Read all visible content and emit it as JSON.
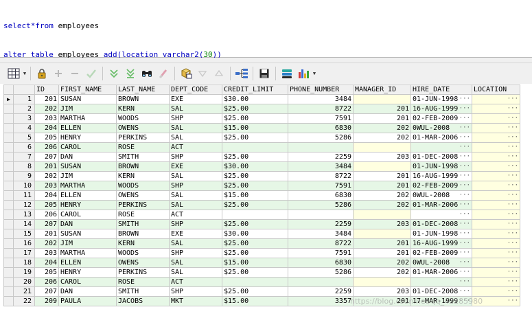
{
  "editor": {
    "line1": [
      {
        "text": "select*from",
        "cls": "kw"
      },
      {
        "text": " employees",
        "cls": "plain"
      }
    ],
    "line2": [
      {
        "text": "alter table",
        "cls": "kw"
      },
      {
        "text": " employees ",
        "cls": "plain"
      },
      {
        "text": "add(location varchar2(",
        "cls": "kw"
      },
      {
        "text": "30",
        "cls": "num"
      },
      {
        "text": "))",
        "cls": "kw"
      }
    ]
  },
  "toolbar": {
    "icons": [
      "grid-options-icon",
      "lock-icon",
      "add-record-icon",
      "delete-record-icon",
      "post-changes-icon",
      "fetch-next-icon",
      "fetch-last-icon",
      "find-icon",
      "clear-icon",
      "query-by-example-icon",
      "filter-down-icon",
      "filter-up-icon",
      "tree-view-icon",
      "save-icon",
      "export-icon",
      "chart-icon"
    ]
  },
  "grid": {
    "columns": [
      "ID",
      "FIRST_NAME",
      "LAST_NAME",
      "DEPT_CODE",
      "CREDIT_LIMIT",
      "PHONE_NUMBER",
      "MANAGER_ID",
      "HIRE_DATE",
      "LOCATION"
    ],
    "rows": [
      {
        "n": "1",
        "id": "201",
        "first": "SUSAN",
        "last": "BROWN",
        "dept": "EXE",
        "credit": "$30.00",
        "phone": "3484",
        "mgr": "",
        "hire": "01-JUN-1998"
      },
      {
        "n": "2",
        "id": "202",
        "first": "JIM",
        "last": "KERN",
        "dept": "SAL",
        "credit": "$25.00",
        "phone": "8722",
        "mgr": "201",
        "hire": "16-AUG-1999"
      },
      {
        "n": "3",
        "id": "203",
        "first": "MARTHA",
        "last": "WOODS",
        "dept": "SHP",
        "credit": "$25.00",
        "phone": "7591",
        "mgr": "201",
        "hire": "02-FEB-2009"
      },
      {
        "n": "4",
        "id": "204",
        "first": "ELLEN",
        "last": "OWENS",
        "dept": "SAL",
        "credit": "$15.00",
        "phone": "6830",
        "mgr": "202",
        "hire": "0WUL-2008"
      },
      {
        "n": "5",
        "id": "205",
        "first": "HENRY",
        "last": "PERKINS",
        "dept": "SAL",
        "credit": "$25.00",
        "phone": "5286",
        "mgr": "202",
        "hire": "01-MAR-2006"
      },
      {
        "n": "6",
        "id": "206",
        "first": "CAROL",
        "last": "ROSE",
        "dept": "ACT",
        "credit": "",
        "phone": "",
        "mgr": "",
        "hire": ""
      },
      {
        "n": "7",
        "id": "207",
        "first": "DAN",
        "last": "SMITH",
        "dept": "SHP",
        "credit": "$25.00",
        "phone": "2259",
        "mgr": "203",
        "hire": "01-DEC-2008"
      },
      {
        "n": "8",
        "id": "201",
        "first": "SUSAN",
        "last": "BROWN",
        "dept": "EXE",
        "credit": "$30.00",
        "phone": "3484",
        "mgr": "",
        "hire": "01-JUN-1998"
      },
      {
        "n": "9",
        "id": "202",
        "first": "JIM",
        "last": "KERN",
        "dept": "SAL",
        "credit": "$25.00",
        "phone": "8722",
        "mgr": "201",
        "hire": "16-AUG-1999"
      },
      {
        "n": "10",
        "id": "203",
        "first": "MARTHA",
        "last": "WOODS",
        "dept": "SHP",
        "credit": "$25.00",
        "phone": "7591",
        "mgr": "201",
        "hire": "02-FEB-2009"
      },
      {
        "n": "11",
        "id": "204",
        "first": "ELLEN",
        "last": "OWENS",
        "dept": "SAL",
        "credit": "$15.00",
        "phone": "6830",
        "mgr": "202",
        "hire": "0WUL-2008"
      },
      {
        "n": "12",
        "id": "205",
        "first": "HENRY",
        "last": "PERKINS",
        "dept": "SAL",
        "credit": "$25.00",
        "phone": "5286",
        "mgr": "202",
        "hire": "01-MAR-2006"
      },
      {
        "n": "13",
        "id": "206",
        "first": "CAROL",
        "last": "ROSE",
        "dept": "ACT",
        "credit": "",
        "phone": "",
        "mgr": "",
        "hire": ""
      },
      {
        "n": "14",
        "id": "207",
        "first": "DAN",
        "last": "SMITH",
        "dept": "SHP",
        "credit": "$25.00",
        "phone": "2259",
        "mgr": "203",
        "hire": "01-DEC-2008"
      },
      {
        "n": "15",
        "id": "201",
        "first": "SUSAN",
        "last": "BROWN",
        "dept": "EXE",
        "credit": "$30.00",
        "phone": "3484",
        "mgr": "",
        "hire": "01-JUN-1998"
      },
      {
        "n": "16",
        "id": "202",
        "first": "JIM",
        "last": "KERN",
        "dept": "SAL",
        "credit": "$25.00",
        "phone": "8722",
        "mgr": "201",
        "hire": "16-AUG-1999"
      },
      {
        "n": "17",
        "id": "203",
        "first": "MARTHA",
        "last": "WOODS",
        "dept": "SHP",
        "credit": "$25.00",
        "phone": "7591",
        "mgr": "201",
        "hire": "02-FEB-2009"
      },
      {
        "n": "18",
        "id": "204",
        "first": "ELLEN",
        "last": "OWENS",
        "dept": "SAL",
        "credit": "$15.00",
        "phone": "6830",
        "mgr": "202",
        "hire": "0WUL-2008"
      },
      {
        "n": "19",
        "id": "205",
        "first": "HENRY",
        "last": "PERKINS",
        "dept": "SAL",
        "credit": "$25.00",
        "phone": "5286",
        "mgr": "202",
        "hire": "01-MAR-2006"
      },
      {
        "n": "20",
        "id": "206",
        "first": "CAROL",
        "last": "ROSE",
        "dept": "ACT",
        "credit": "",
        "phone": "",
        "mgr": "",
        "hire": ""
      },
      {
        "n": "21",
        "id": "207",
        "first": "DAN",
        "last": "SMITH",
        "dept": "SHP",
        "credit": "$25.00",
        "phone": "2259",
        "mgr": "203",
        "hire": "01-DEC-2008"
      },
      {
        "n": "22",
        "id": "209",
        "first": "PAULA",
        "last": "JACOBS",
        "dept": "MKT",
        "credit": "$15.00",
        "phone": "3357",
        "mgr": "201",
        "hire": "17-MAR-1999"
      }
    ],
    "ellipsis": "···",
    "current_row_marker": "▶"
  },
  "watermark": "https://blog.csdn.net/qq_42285980"
}
